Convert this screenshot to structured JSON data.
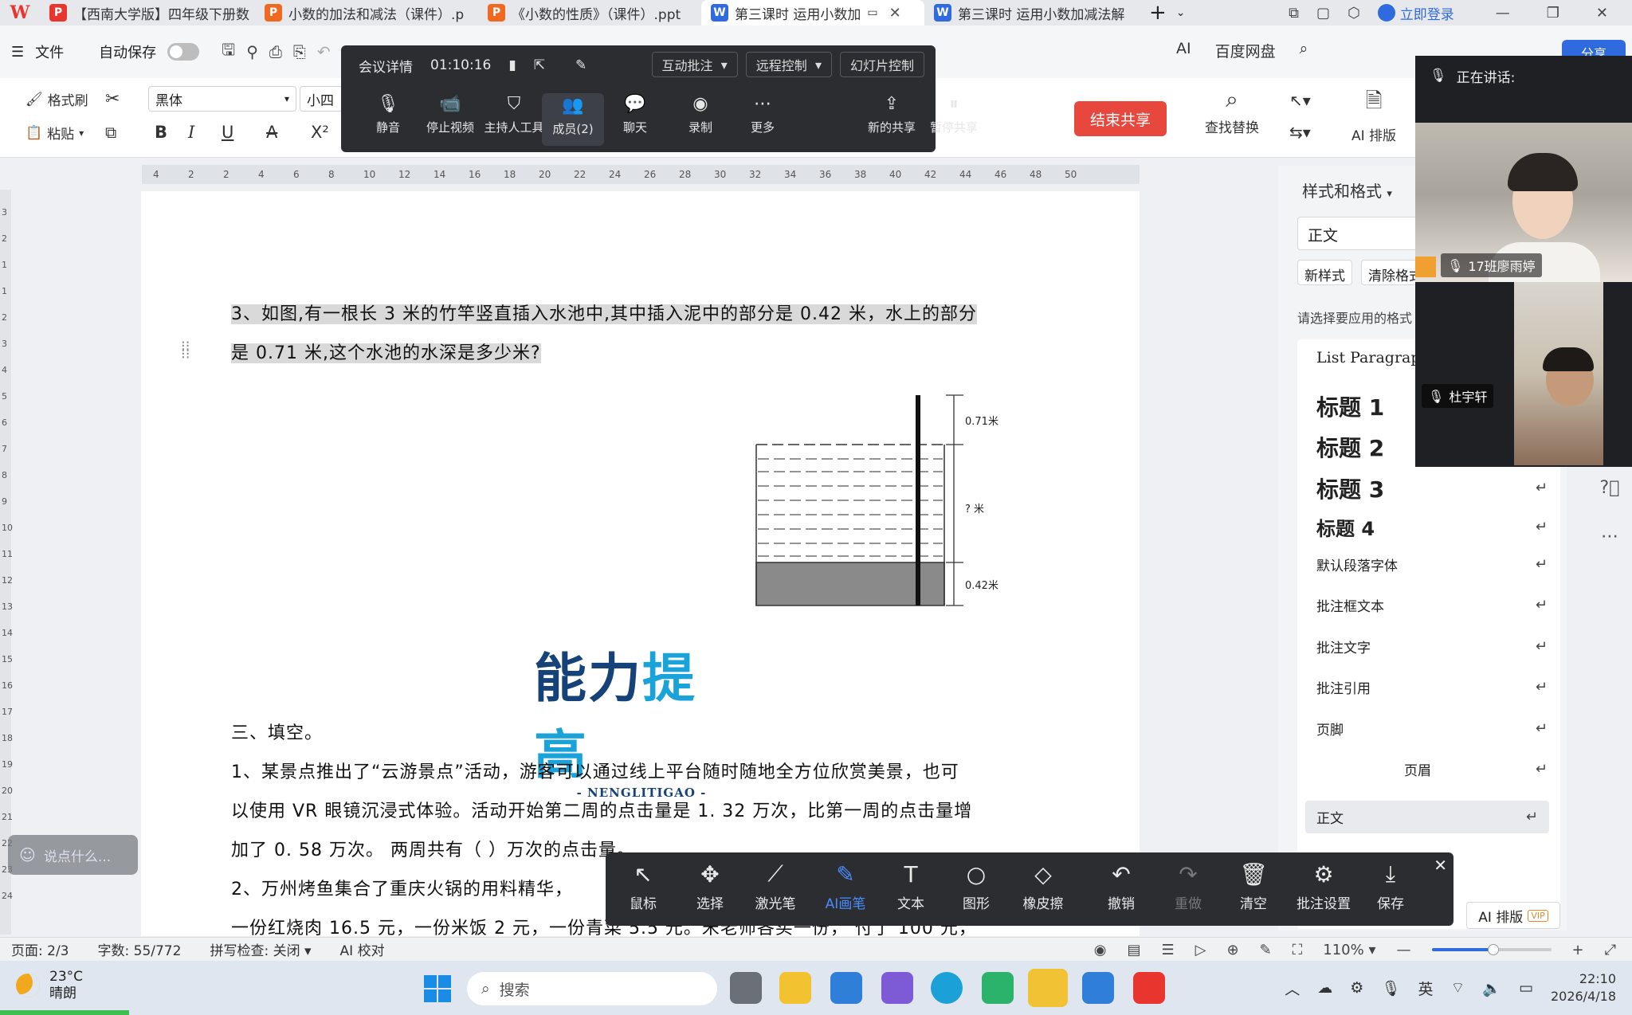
{
  "tabs": [
    {
      "label": "【西南大学版】四年级下册数",
      "kind": "wps-pdf",
      "color": "#e8352e"
    },
    {
      "label": "小数的加法和减法（课件）.p",
      "kind": "ppt",
      "color": "#ef6a20"
    },
    {
      "label": "《小数的性质》（课件）.ppt",
      "kind": "ppt",
      "color": "#ef6a20"
    },
    {
      "label": "第三课时  运用小数加",
      "kind": "doc",
      "color": "#2f6bde",
      "active": true
    },
    {
      "label": "第三课时  运用小数加减法解",
      "kind": "doc",
      "color": "#2f6bde"
    }
  ],
  "titlebar": {
    "login": "立即登录",
    "add_tab": "+"
  },
  "menu": {
    "file": "文件",
    "autosave": "自动保存",
    "ai": "AI",
    "baidu": "百度网盘",
    "share": "分享"
  },
  "ribbon": {
    "format_painter": "格式刷",
    "paste": "粘贴",
    "font_name": "黑体",
    "font_size": "小四",
    "find_replace": "查找替换",
    "ai_layout": "AI 排版"
  },
  "meeting": {
    "details": "会议详情",
    "timer": "01:10:16",
    "top_buttons": [
      "互动批注",
      "远程控制",
      "幻灯片控制"
    ],
    "tools": [
      {
        "label": "静音",
        "icon": "microphone-icon"
      },
      {
        "label": "停止视频",
        "icon": "video-camera-icon"
      },
      {
        "label": "主持人工具",
        "icon": "shield-icon"
      },
      {
        "label": "成员(2)",
        "icon": "members-icon",
        "selected": true
      },
      {
        "label": "聊天",
        "icon": "chat-icon"
      },
      {
        "label": "录制",
        "icon": "record-icon"
      },
      {
        "label": "更多",
        "icon": "more-icon"
      },
      {
        "label": "新的共享",
        "icon": "new-share-icon"
      },
      {
        "label": "暂停共享",
        "icon": "pause-share-icon"
      }
    ],
    "end_share": "结束共享"
  },
  "ruler": {
    "marks": [
      "4",
      "2",
      "2",
      "4",
      "6",
      "8",
      "10",
      "12",
      "14",
      "16",
      "18",
      "20",
      "22",
      "24",
      "26",
      "28",
      "30",
      "32",
      "34",
      "36",
      "38",
      "40",
      "42",
      "44",
      "46",
      "48",
      "50"
    ]
  },
  "vruler": {
    "marks": [
      "3",
      "2",
      "1",
      "1",
      "2",
      "3",
      "4",
      "5",
      "6",
      "7",
      "8",
      "9",
      "10",
      "11",
      "12",
      "13",
      "14",
      "15",
      "16",
      "17",
      "18",
      "19",
      "20",
      "21",
      "22",
      "23",
      "24"
    ]
  },
  "document": {
    "q3_line1": "3、如图,有一根长 3 米的竹竿竖直插入水池中,其中插入泥中的部分是 0.42 米，水上的部分",
    "q3_line2": "是 0.71 米,这个水池的水深是多少米?",
    "diagram": {
      "top_label": "0.71米",
      "mid_label": "? 米",
      "bottom_label": "0.42米"
    },
    "logo_cn_a": "能力",
    "logo_cn_b": "提高",
    "logo_en": "- NENGLITIGAO -",
    "section3": "三、填空。",
    "fill1_line1": "1、某景点推出了“云游景点”活动，游客可以通过线上平台随时随地全方位欣赏美景，也可",
    "fill1_line2": "以使用  VR  眼镜沉浸式体验。活动开始第二周的点击量是  1. 32  万次，比第一周的点击量增",
    "fill1_line3": "加了  0. 58  万次。  两周共有（            ）万次的点击量。",
    "fill2_line1": "2、万州烤鱼集合了重庆火锅的用料精华，",
    "fill2_line2": "一份红烧肉  16.5  元，一份米饭  2  元，一份青菜  5.5  元。宋老师各买一份，  付了  100  元，"
  },
  "stylepane": {
    "title": "样式和格式",
    "current": "正文",
    "new_style": "新样式",
    "clear_format": "清除格式",
    "hint": "请选择要应用的格式",
    "items": [
      {
        "label": "List Paragraph",
        "kind": "lp"
      },
      {
        "label": "标题  1",
        "kind": "h"
      },
      {
        "label": "标题  2",
        "kind": "h"
      },
      {
        "label": "标题  3",
        "kind": "h"
      },
      {
        "label": "标题  4",
        "kind": "h4"
      },
      {
        "label": "默认段落字体",
        "kind": "n"
      },
      {
        "label": "批注框文本",
        "kind": "n"
      },
      {
        "label": "批注文字",
        "kind": "n"
      },
      {
        "label": "批注引用",
        "kind": "n"
      },
      {
        "label": "页脚",
        "kind": "n"
      },
      {
        "label": "页眉",
        "kind": "c"
      },
      {
        "label": "正文",
        "kind": "sel"
      }
    ],
    "ai_layout": "AI 排版",
    "vip": "VIP"
  },
  "video": {
    "speaking": "正在讲话:",
    "participant1": "17班廖雨婷",
    "participant2": "杜宇轩"
  },
  "chat_placeholder": "说点什么...",
  "annotation": {
    "tools": [
      {
        "label": "鼠标",
        "icon": "cursor-icon"
      },
      {
        "label": "选择",
        "icon": "move-icon"
      },
      {
        "label": "激光笔",
        "icon": "laser-pointer-icon"
      },
      {
        "label": "AI画笔",
        "icon": "ai-pen-icon",
        "active": true
      },
      {
        "label": "文本",
        "icon": "text-icon"
      },
      {
        "label": "图形",
        "icon": "shape-icon"
      },
      {
        "label": "橡皮擦",
        "icon": "eraser-icon"
      },
      {
        "label": "撤销",
        "icon": "undo-icon"
      },
      {
        "label": "重做",
        "icon": "redo-icon",
        "disabled": true
      },
      {
        "label": "清空",
        "icon": "trash-icon"
      },
      {
        "label": "批注设置",
        "icon": "settings-icon"
      },
      {
        "label": "保存",
        "icon": "download-icon"
      }
    ]
  },
  "status": {
    "page": "页面: 2/3",
    "words": "字数: 55/772",
    "spell": "拼写检查: 关闭",
    "ai_check": "AI 校对",
    "zoom": "110%",
    "zoom_fraction": 0.5
  },
  "taskbar": {
    "temp": "23°C",
    "weather": "晴朗",
    "search": "搜索",
    "lang": "英",
    "time": "22:10",
    "date": "2026/4/18"
  }
}
